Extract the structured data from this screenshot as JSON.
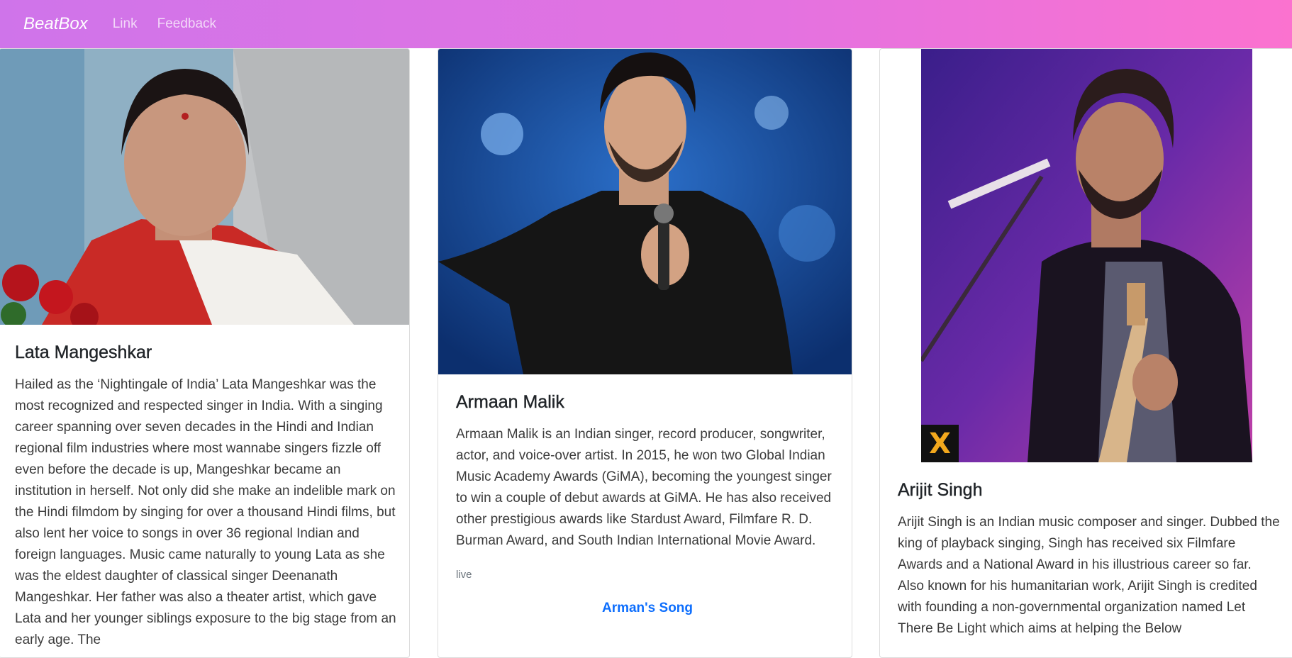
{
  "navbar": {
    "brand": "BeatBox",
    "links": [
      "Link",
      "Feedback"
    ]
  },
  "cards": [
    {
      "name": "Lata Mangeshkar",
      "bio": "Hailed as the ‘Nightingale of India’ Lata Mangeshkar was the most recognized and respected singer in India. With a singing career spanning over seven decades in the Hindi and Indian regional film industries where most wannabe singers fizzle off even before the decade is up, Mangeshkar became an institution in herself. Not only did she make an indelible mark on the Hindi filmdom by singing for over a thousand Hindi films, but also lent her voice to songs in over 36 regional Indian and foreign languages. Music came naturally to young Lata as she was the eldest daughter of classical singer Deenanath Mangeshkar. Her father was also a theater artist, which gave Lata and her younger siblings exposure to the big stage from an early age. The"
    },
    {
      "name": "Armaan Malik",
      "bio": "Armaan Malik is an Indian singer, record producer, songwriter, actor, and voice-over artist. In 2015, he won two Global Indian Music Academy Awards (GiMA), becoming the youngest singer to win a couple of debut awards at GiMA. He has also received other prestigious awards like Stardust Award, Filmfare R. D. Burman Award, and South Indian International Movie Award.",
      "meta": "live",
      "song_link": "Arman's Song"
    },
    {
      "name": "Arijit Singh",
      "bio": "Arijit Singh is an Indian music composer and singer. Dubbed the king of playback singing, Singh has received six Filmfare Awards and a National Award in his illustrious career so far. Also known for his humanitarian work, Arijit Singh is credited with founding a non-governmental organization named Let There Be Light which aims at helping the Below",
      "badge": "X"
    }
  ],
  "colors": {
    "nav_gradient_start": "#cf74ea",
    "nav_gradient_end": "#fb72cf",
    "link": "#0d6efd"
  }
}
